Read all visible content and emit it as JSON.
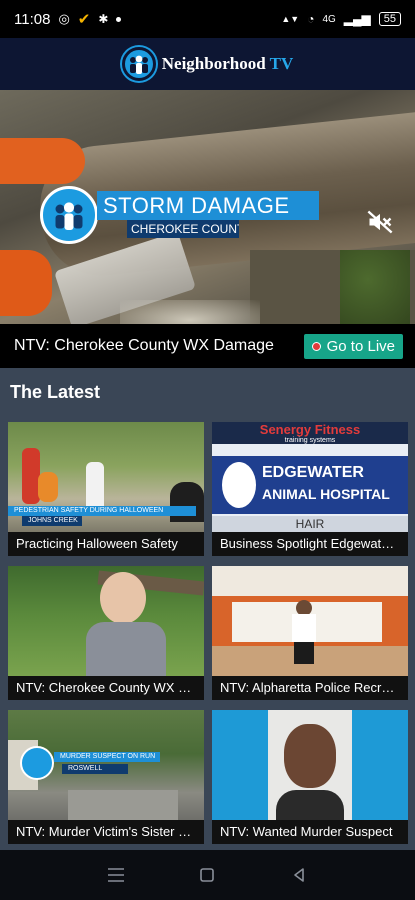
{
  "status_bar": {
    "time": "11:08",
    "network": "4G",
    "battery": "55"
  },
  "app": {
    "title_main": "Neighborhood",
    "title_tv": "TV"
  },
  "hero": {
    "headline": "STORM DAMAGE",
    "subheadline": "CHEROKEE COUNTY",
    "now_playing": "NTV: Cherokee County WX Damage",
    "live_button": "Go to Live"
  },
  "latest": {
    "heading": "The Latest",
    "cards": [
      {
        "caption": "Practicing Halloween Safety",
        "overlay_title": "PEDESTRIAN SAFETY DURING HALLOWEEN",
        "overlay_sub": "JOHNS CREEK"
      },
      {
        "caption": "Business Spotlight Edgewater Animal Hospital",
        "sign_top": "Senergy Fitness",
        "sign_top_sub": "training systems",
        "sign_main": "EDGEWATER",
        "sign_main2": "ANIMAL HOSPITAL",
        "sign_bottom": "HAIR"
      },
      {
        "caption": "NTV: Cherokee County WX Damage"
      },
      {
        "caption": "NTV: Alpharetta Police Recruitment"
      },
      {
        "caption": "NTV: Murder Victim's Sister Speaks",
        "overlay_title": "MURDER SUSPECT ON RUN",
        "overlay_sub": "ROSWELL"
      },
      {
        "caption": "NTV: Wanted Murder Suspect"
      }
    ]
  },
  "colors": {
    "brand_blue": "#1c9be0",
    "header_navy": "#0d1633",
    "live_green": "#17a589",
    "latest_bg": "#3a4656"
  }
}
